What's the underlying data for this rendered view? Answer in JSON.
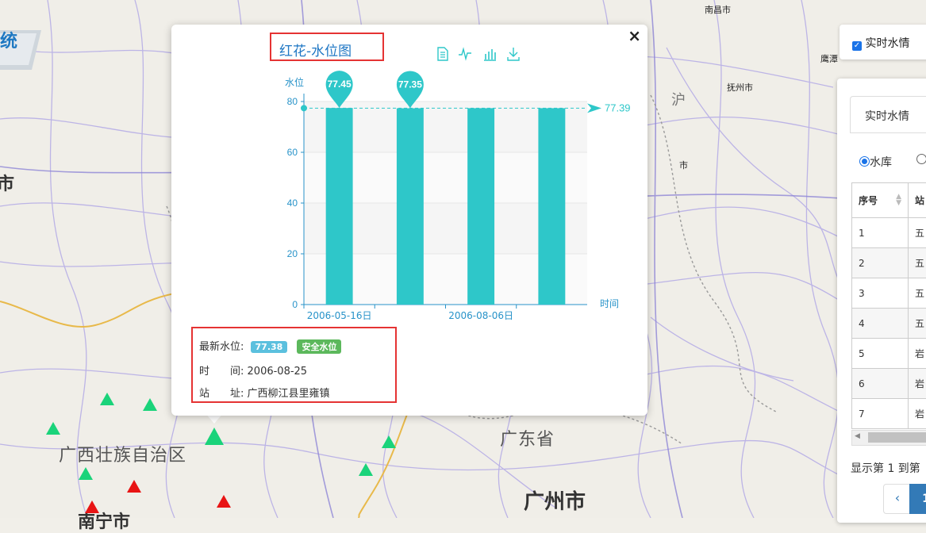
{
  "map": {
    "labels": {
      "nanchang": "南昌市",
      "fuzhou": "抚州市",
      "yingtan": "鹰潭",
      "shi_partial": "市",
      "shi_left": "市",
      "guangxi": "广西壮族自治区",
      "guangdong": "广东省",
      "guangzhou": "广州市",
      "nanning_partial": "南宁市",
      "logo_partial": "统",
      "chu": "沪"
    }
  },
  "popup": {
    "title": "红花-水位图",
    "close": "×",
    "toolbox": [
      "data-view-icon",
      "line-chart-icon",
      "bar-chart-icon",
      "download-icon"
    ],
    "info": {
      "latest_label": "最新水位:",
      "latest_value": "77.38",
      "status": "安全水位",
      "time_label": "时　　间:",
      "time_value": "2006-08-25",
      "addr_label": "站　　址:",
      "addr_value": "广西柳江县里雍镇"
    }
  },
  "chart_data": {
    "type": "bar",
    "ylabel": "水位",
    "xlabel": "时间",
    "ylim": [
      0,
      80
    ],
    "yticks": [
      0,
      20,
      40,
      60,
      80
    ],
    "categories": [
      "2006-05-16日",
      "",
      "2006-08-06日",
      ""
    ],
    "values": [
      77.45,
      77.35,
      77.38,
      77.38
    ],
    "max_markers": [
      "77.45",
      "77.35"
    ],
    "markline": {
      "value": 77.39,
      "label": "77.39"
    },
    "color": "#2ec7c9"
  },
  "right": {
    "checkbox_label": "实时水情",
    "checkbox_checked": true,
    "tab_label": "实时水情",
    "radio_label": "水库",
    "table_headers": [
      "序号",
      "站"
    ],
    "rows": [
      [
        "1",
        "五"
      ],
      [
        "2",
        "五"
      ],
      [
        "3",
        "五"
      ],
      [
        "4",
        "五"
      ],
      [
        "5",
        "岩"
      ],
      [
        "6",
        "岩"
      ],
      [
        "7",
        "岩"
      ]
    ],
    "footer_text": "显示第 1 到第",
    "prev_btn": "‹",
    "page_btn": "1"
  },
  "colors": {
    "accent": "#2ec7c9",
    "danger": "#e53333",
    "info": "#5bc0de",
    "success": "#5cb85c"
  }
}
